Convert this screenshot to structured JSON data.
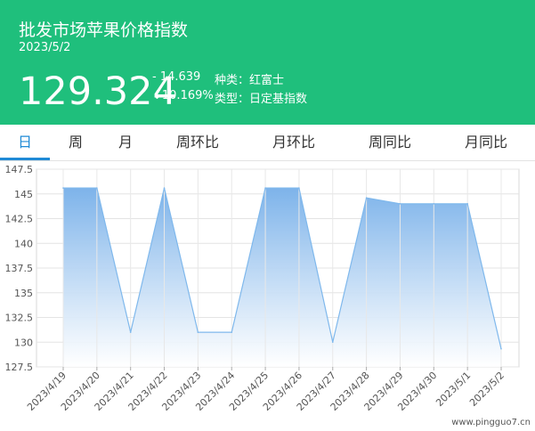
{
  "header": {
    "title": "批发市场苹果价格指数",
    "date": "2023/5/2",
    "index_value": "129.324",
    "change_abs": "- 14.639",
    "change_pct": "↓10.169%",
    "variety": "种类：红富士",
    "type": "类型：日定基指数"
  },
  "tabs": [
    {
      "label": "日",
      "active": true
    },
    {
      "label": "周",
      "active": false
    },
    {
      "label": "月",
      "active": false
    },
    {
      "label": "周环比",
      "active": false
    },
    {
      "label": "月环比",
      "active": false
    },
    {
      "label": "周同比",
      "active": false
    },
    {
      "label": "月同比",
      "active": false
    }
  ],
  "watermark": "www.pingguo7.cn",
  "colors": {
    "header_bg": "#1fbf7c",
    "active_tab": "#1f8ad6",
    "line": "#7fb8ec",
    "area_top": "#7db3ea",
    "area_bottom": "#ffffff"
  },
  "chart_data": {
    "type": "area",
    "title": "",
    "xlabel": "",
    "ylabel": "",
    "x": [
      "2023/4/19",
      "2023/4/20",
      "2023/4/21",
      "2023/4/22",
      "2023/4/23",
      "2023/4/24",
      "2023/4/25",
      "2023/4/26",
      "2023/4/27",
      "2023/4/28",
      "2023/4/29",
      "2023/4/30",
      "2023/5/1",
      "2023/5/2"
    ],
    "series": [
      {
        "values": [
          145.6,
          145.6,
          131.0,
          145.6,
          131.0,
          131.0,
          145.6,
          145.6,
          130.0,
          144.6,
          144.0,
          144.0,
          144.0,
          129.324
        ]
      }
    ],
    "y_ticks": [
      127.5,
      130,
      132.5,
      135,
      137.5,
      140,
      142.5,
      145,
      147.5
    ],
    "y_tick_labels": [
      "127.5",
      "130",
      "132.5",
      "135",
      "137.5",
      "140",
      "142.5",
      "145",
      "147.5"
    ],
    "ylim": [
      127.5,
      147.5
    ],
    "grid": true,
    "legend": "none"
  }
}
